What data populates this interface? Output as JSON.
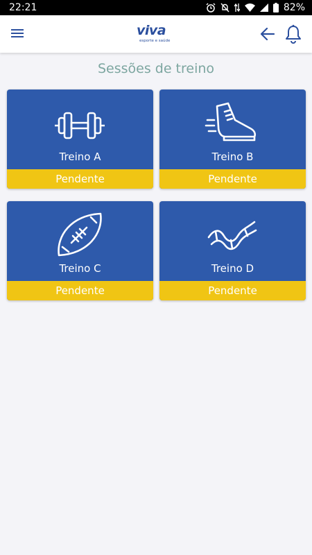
{
  "status_bar": {
    "time": "22:21",
    "battery": "82%",
    "icons": [
      "alarm-icon",
      "mute-icon",
      "data-icon",
      "wifi-icon",
      "signal-icon",
      "battery-icon"
    ]
  },
  "app_bar": {
    "menu_icon": "menu-icon",
    "logo_text": "viva",
    "logo_subtext": "esporte e saúde",
    "back_icon": "arrow-back-icon",
    "bell_icon": "bell-icon"
  },
  "page": {
    "title": "Sessões de treino"
  },
  "sessions": [
    {
      "name": "Treino A",
      "status": "Pendente",
      "icon": "dumbbell-icon"
    },
    {
      "name": "Treino B",
      "status": "Pendente",
      "icon": "running-shoe-icon"
    },
    {
      "name": "Treino C",
      "status": "Pendente",
      "icon": "football-icon"
    },
    {
      "name": "Treino D",
      "status": "Pendente",
      "icon": "dna-icon"
    }
  ],
  "colors": {
    "card_bg": "#2e5aab",
    "status_bg": "#f0c514",
    "title": "#7da6a0",
    "brand": "#2b4f9e"
  }
}
